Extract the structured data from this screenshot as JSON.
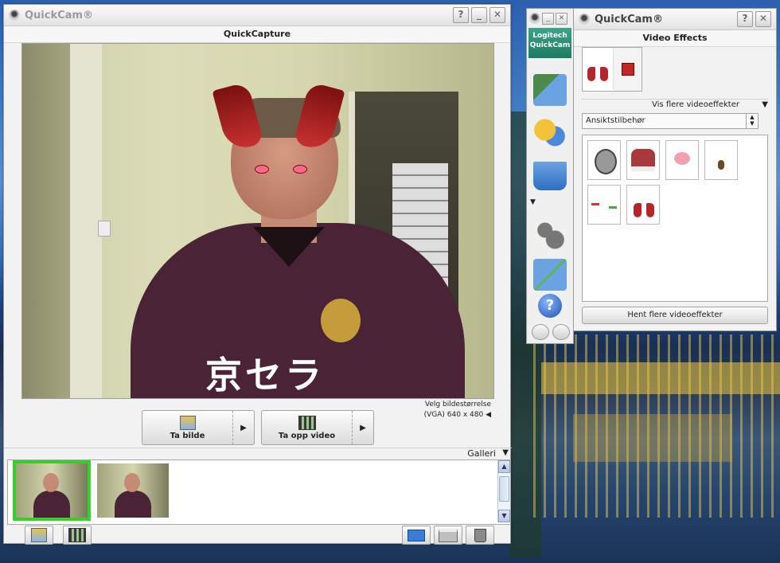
{
  "main_window": {
    "title": "QuickCam®",
    "help": "?",
    "minimize": "_",
    "close": "✕",
    "section": "QuickCapture",
    "video_text": "京セラ",
    "resolution_label": "Velg bildestørrelse",
    "resolution_value": "(VGA) 640 x 480",
    "resolution_arrow": "◀",
    "buttons": {
      "photo": "Ta bilde",
      "video": "Ta opp video",
      "arrow": "▶"
    },
    "gallery": {
      "title": "Galleri",
      "arrow": "▼",
      "thumbnails": [
        {
          "selected": true
        },
        {
          "selected": false
        }
      ],
      "scroll_up": "▲",
      "scroll_down": "▼"
    }
  },
  "toolbar": {
    "brand_line1": "Logitech",
    "brand_line2": "QuickCam",
    "help_icon": "?",
    "collapse": "▼",
    "icons": [
      "capture-icon",
      "effects-masks-icon",
      "whiteboard-icon",
      "settings-gears-icon",
      "video-call-icon",
      "help-icon"
    ]
  },
  "effects_window": {
    "title": "QuickCam®",
    "help": "?",
    "close": "✕",
    "section": "Video Effects",
    "more_effects": "Vis flere videoeffekter",
    "more_arrow": "▼",
    "category": "Ansiktstilbehør",
    "get_more": "Hent flere videoeffekter"
  },
  "colors": {
    "selected_outline": "#35d12a",
    "brand": "#1e7a63",
    "stop": "#c42525"
  }
}
